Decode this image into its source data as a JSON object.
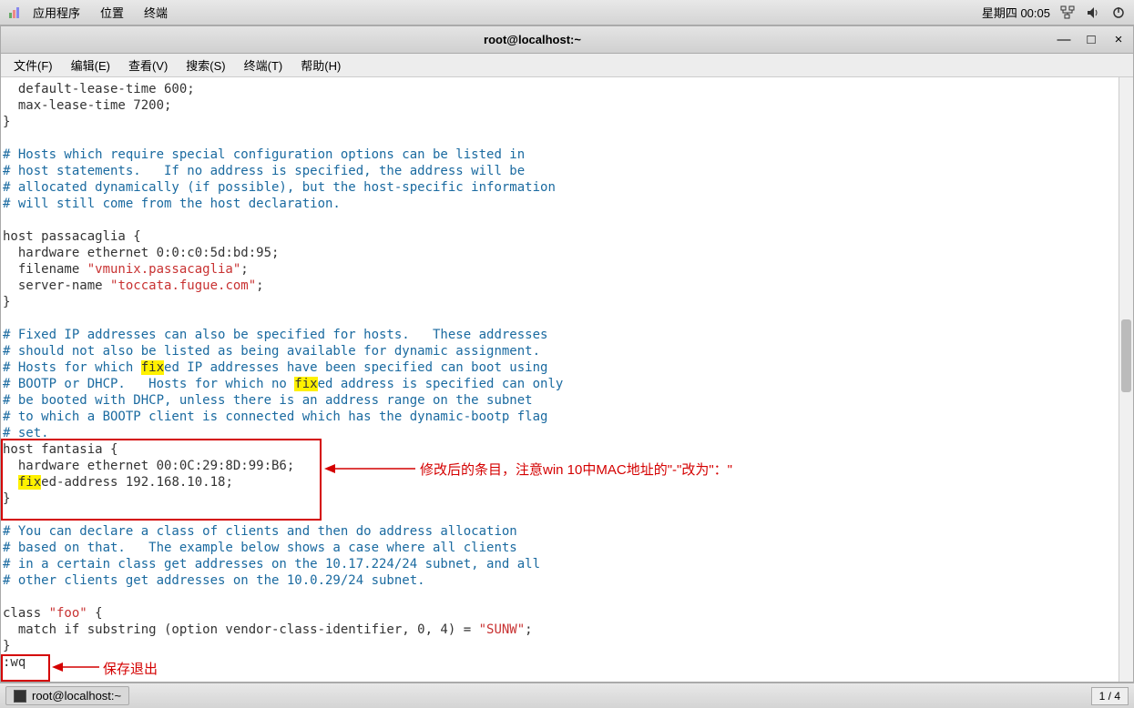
{
  "panel_top": {
    "menu1": "应用程序",
    "menu2": "位置",
    "menu3": "终端",
    "datetime": "星期四 00:05"
  },
  "window": {
    "title": "root@localhost:~",
    "minimize": "—",
    "maximize": "□",
    "close": "×"
  },
  "menubar": {
    "file": "文件(F)",
    "edit": "编辑(E)",
    "view": "查看(V)",
    "search": "搜索(S)",
    "terminal": "终端(T)",
    "help": "帮助(H)"
  },
  "term": {
    "l1": "  default-lease-time 600;",
    "l2": "  max-lease-time 7200;",
    "l3": "}",
    "c1": "# Hosts which require special configuration options can be listed in",
    "c2": "# host statements.   If no address is specified, the address will be",
    "c3": "# allocated dynamically (if possible), but the host-specific information",
    "c4": "# will still come from the host declaration.",
    "h1a": "host passacaglia {",
    "h1b": "  hardware ethernet 0:0:c0:5d:bd:95;",
    "h1c_pre": "  filename ",
    "h1c_str": "\"vmunix.passacaglia\"",
    "h1c_post": ";",
    "h1d_pre": "  server-name ",
    "h1d_str": "\"toccata.fugue.com\"",
    "h1d_post": ";",
    "h1e": "}",
    "c5": "# Fixed IP addresses can also be specified for hosts.   These addresses",
    "c6": "# should not also be listed as being available for dynamic assignment.",
    "c7a": "# Hosts for which ",
    "c7hl": "fix",
    "c7b": "ed IP addresses have been specified can boot using",
    "c8a": "# BOOTP or DHCP.   Hosts for which no ",
    "c8hl": "fix",
    "c8b": "ed address is specified can only",
    "c9": "# be booted with DHCP, unless there is an address range on the subnet",
    "c10": "# to which a BOOTP client is connected which has the dynamic-bootp flag",
    "c11": "# set.",
    "h2a": "host fantasia {",
    "h2b": "  hardware ethernet 00:0C:29:8D:99:B6;",
    "h2c_pre": "  ",
    "h2c_hl": "fix",
    "h2c_post": "ed-address 192.168.10.18;",
    "h2d": "}",
    "c12": "# You can declare a class of clients and then do address allocation",
    "c13": "# based on that.   The example below shows a case where all clients",
    "c14": "# in a certain class get addresses on the 10.17.224/24 subnet, and all",
    "c15": "# other clients get addresses on the 10.0.29/24 subnet.",
    "cl1a": "class ",
    "cl1b": "\"foo\"",
    "cl1c": " {",
    "cl2a": "  match if substring (option vendor-class-identifier, 0, 4) = ",
    "cl2b": "\"SUNW\"",
    "cl2c": ";",
    "cl3": "}",
    "cmd": ":wq"
  },
  "annotations": {
    "note1": "修改后的条目，注意win 10中MAC地址的\"-\"改为\"：\"",
    "note2": "保存退出"
  },
  "bottom": {
    "task": "root@localhost:~",
    "workspace": "1 / 4"
  }
}
